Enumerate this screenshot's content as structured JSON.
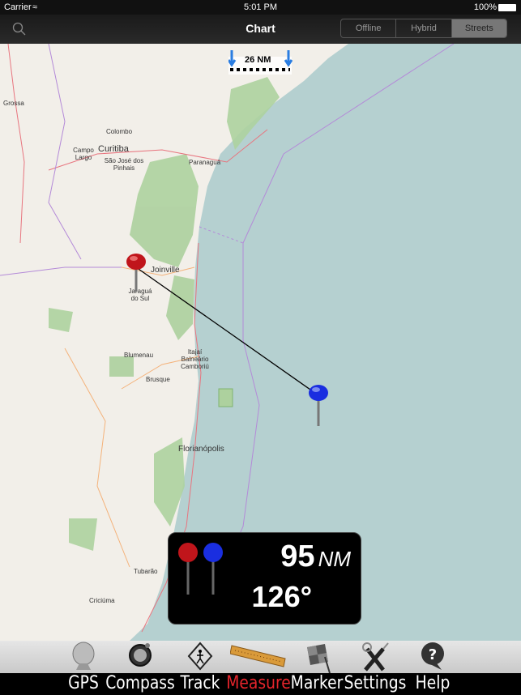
{
  "status": {
    "carrier": "Carrier",
    "time": "5:01 PM",
    "battery": "100%"
  },
  "nav": {
    "title": "Chart",
    "segments": [
      "Offline",
      "Hybrid",
      "Streets"
    ],
    "selected": "Streets"
  },
  "map": {
    "scale": "26 NM",
    "places": [
      {
        "name": "Grossa"
      },
      {
        "name": "Colombo"
      },
      {
        "name": "Campo Largo"
      },
      {
        "name": "Curitiba"
      },
      {
        "name": "São José dos Pinhais"
      },
      {
        "name": "Paranaguá"
      },
      {
        "name": "Joinville"
      },
      {
        "name": "Jaraguá do Sul"
      },
      {
        "name": "Blumenau"
      },
      {
        "name": "Itajaí Balneário Camboriú"
      },
      {
        "name": "Brusque"
      },
      {
        "name": "Florianópolis"
      },
      {
        "name": "Tubarão"
      },
      {
        "name": "Criciúma"
      }
    ],
    "colors": {
      "land": "#f2efe9",
      "sea": "#b5d0d0",
      "forest": "#add19e",
      "start_pin": "#c0151b",
      "end_pin": "#1a2ee0"
    }
  },
  "measure": {
    "distance": "95",
    "unit": "NM",
    "bearing": "126°"
  },
  "toolbar": [
    {
      "label": "GPS",
      "icon": "gps-icon"
    },
    {
      "label": "Compass",
      "icon": "compass-icon"
    },
    {
      "label": "Track",
      "icon": "track-icon"
    },
    {
      "label": "Measure",
      "icon": "ruler-icon",
      "active": true
    },
    {
      "label": "Marker",
      "icon": "flag-icon"
    },
    {
      "label": "Settings",
      "icon": "tools-icon"
    },
    {
      "label": "Help",
      "icon": "help-icon"
    }
  ]
}
